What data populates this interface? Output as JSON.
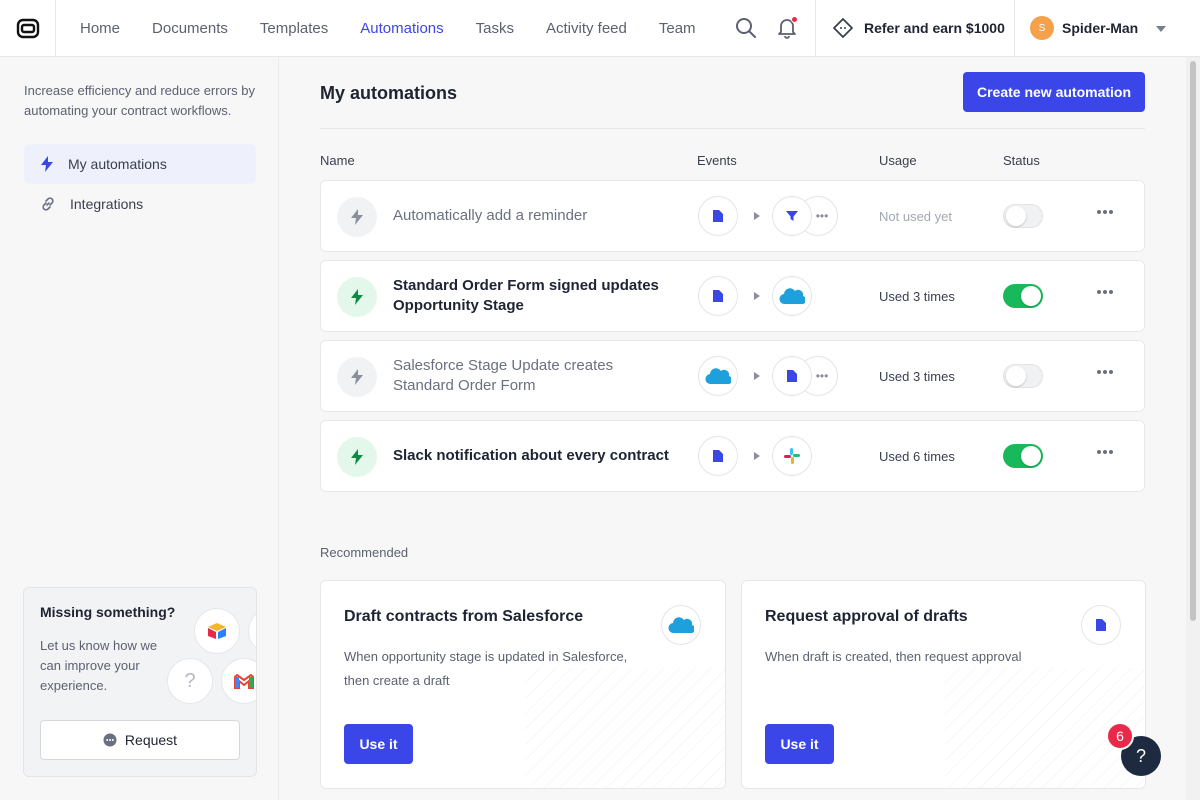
{
  "nav": {
    "items": [
      {
        "label": "Home"
      },
      {
        "label": "Documents"
      },
      {
        "label": "Templates"
      },
      {
        "label": "Automations",
        "active": true
      },
      {
        "label": "Tasks"
      },
      {
        "label": "Activity feed"
      },
      {
        "label": "Team"
      }
    ],
    "refer_label": "Refer and earn $1000",
    "user": {
      "initial": "S",
      "name": "Spider-Man"
    }
  },
  "sidebar": {
    "description": "Increase efficiency and reduce errors by automating your contract workflows.",
    "items": [
      {
        "label": "My automations",
        "icon": "bolt-icon"
      },
      {
        "label": "Integrations",
        "icon": "link-icon"
      }
    ],
    "missing": {
      "title": "Missing something?",
      "text": "Let us know how we can improve your experience.",
      "button_label": "Request"
    }
  },
  "main": {
    "title": "My automations",
    "create_label": "Create new automation",
    "columns": {
      "name": "Name",
      "events": "Events",
      "usage": "Usage",
      "status": "Status"
    },
    "rows": [
      {
        "name": "Automatically add a reminder",
        "enabled": false,
        "usage": "Not used yet",
        "trigger": "document-icon",
        "action": "filter-icon"
      },
      {
        "name": "Standard Order Form signed updates Opportunity Stage",
        "enabled": true,
        "usage": "Used 3 times",
        "trigger": "document-icon",
        "action": "salesforce-icon"
      },
      {
        "name": "Salesforce Stage Update creates Standard Order Form",
        "enabled": false,
        "usage": "Used 3 times",
        "trigger": "salesforce-icon",
        "action": "document-icon"
      },
      {
        "name": "Slack notification about every contract",
        "enabled": true,
        "usage": "Used 6 times",
        "trigger": "document-icon",
        "action": "slack-icon"
      }
    ],
    "recommended_label": "Recommended",
    "cards": [
      {
        "title": "Draft contracts from Salesforce",
        "description": "When opportunity stage is updated in Salesforce, then create a draft",
        "button_label": "Use it",
        "icon": "salesforce-icon"
      },
      {
        "title": "Request approval of drafts",
        "description": "When draft is created, then request approval",
        "button_label": "Use it",
        "icon": "document-icon"
      }
    ]
  },
  "help": {
    "label": "?",
    "badge": "6"
  },
  "colors": {
    "accent": "#3b46e8",
    "success": "#19b85a",
    "alert": "#e8294a"
  }
}
